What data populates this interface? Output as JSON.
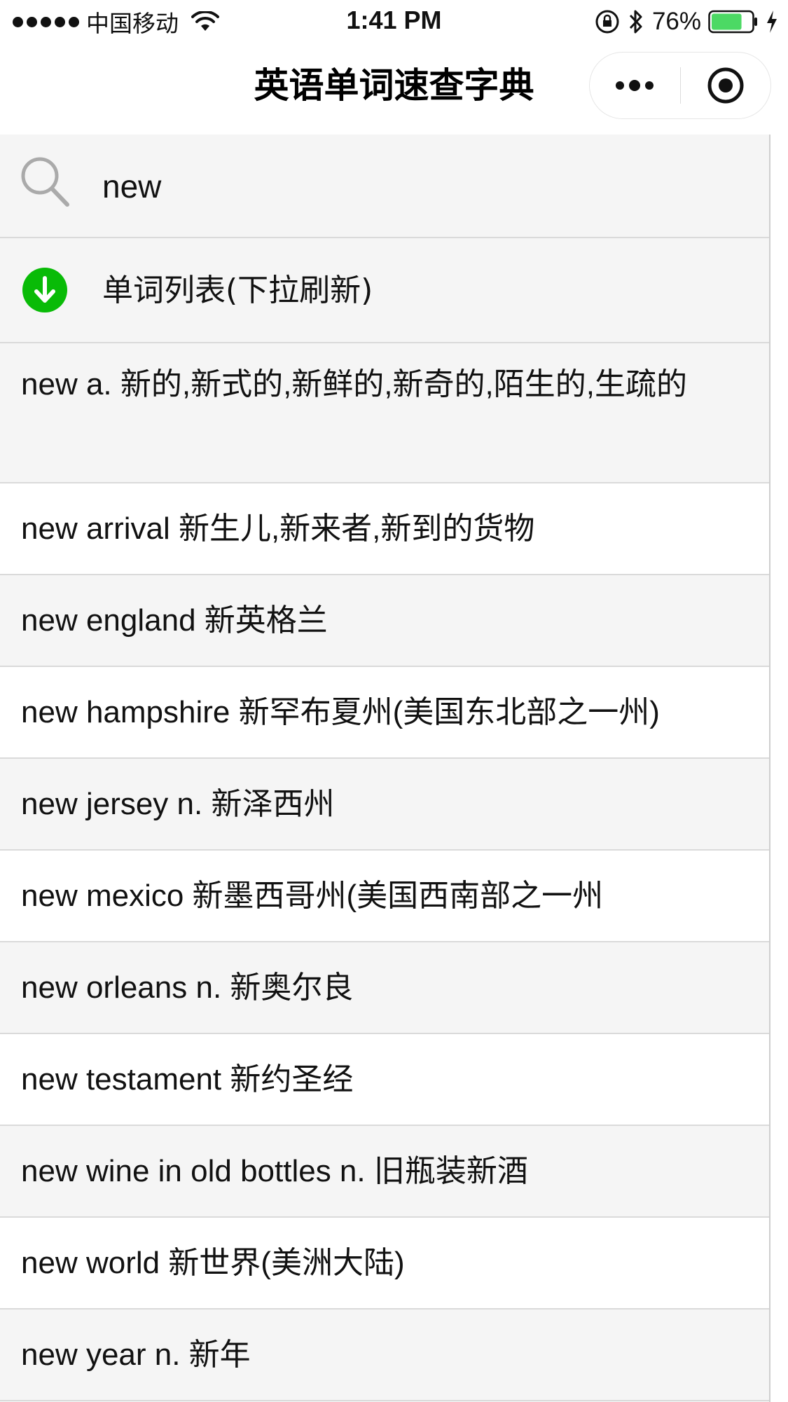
{
  "status_bar": {
    "carrier": "中国移动",
    "time": "1:41 PM",
    "battery_percent": "76%",
    "battery_level": 0.76
  },
  "nav": {
    "title": "英语单词速查字典"
  },
  "search": {
    "value": "new"
  },
  "list_header": {
    "label": "单词列表(下拉刷新)"
  },
  "words": [
    "new a. 新的,新式的,新鲜的,新奇的,陌生的,生疏的",
    "new arrival 新生儿,新来者,新到的货物",
    "new england 新英格兰",
    "new hampshire 新罕布夏州(美国东北部之一州)",
    "new jersey n. 新泽西州",
    "new mexico 新墨西哥州(美国西南部之一州",
    "new orleans n. 新奥尔良",
    "new testament 新约圣经",
    "new wine in old bottles n. 旧瓶装新酒",
    "new world 新世界(美洲大陆)",
    "new year n. 新年"
  ],
  "colors": {
    "accent_green": "#09bb07",
    "battery_green": "#4cd964",
    "row_gray": "#f5f5f5",
    "row_white": "#ffffff"
  },
  "icons": {
    "search": "search-icon",
    "refresh": "arrow-down-circle-icon",
    "more": "more-dots-icon",
    "close": "target-circle-icon"
  }
}
